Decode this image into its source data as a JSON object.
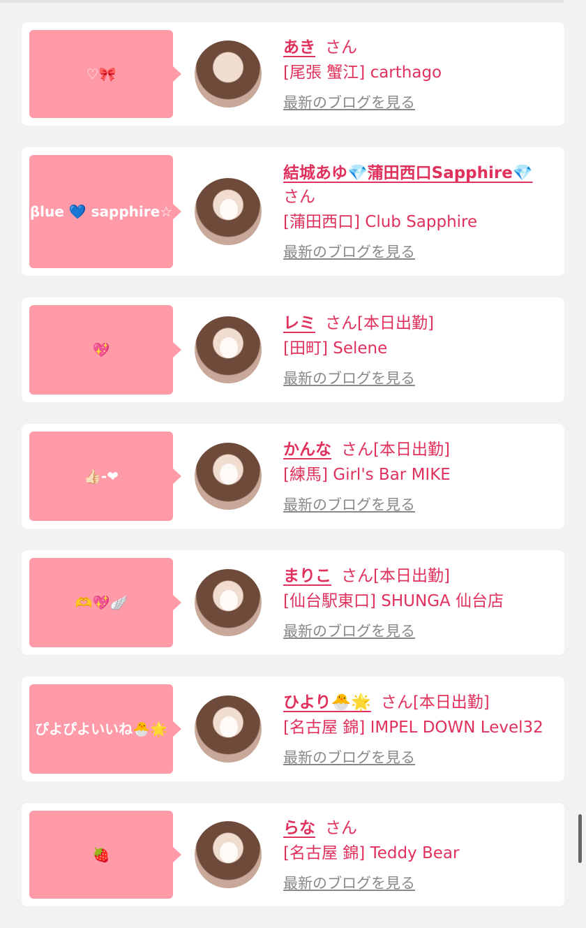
{
  "items": [
    {
      "bubble": "♡🎀",
      "name": "あき",
      "san": "さん",
      "shop": "[尾張 蟹江] carthago",
      "blog": "最新のブログを見る"
    },
    {
      "bubble": "βlue 💙 sapphire☆",
      "name": "結城あゆ💎蒲田西口Sapphire💎",
      "san": "さん",
      "shop": "[蒲田西口] Club Sapphire",
      "blog": "最新のブログを見る"
    },
    {
      "bubble": "💖",
      "name": "レミ",
      "san": "さん[本日出勤]",
      "shop": "[田町] Selene",
      "blog": "最新のブログを見る"
    },
    {
      "bubble": "👍🏻-❤",
      "name": "かんな",
      "san": "さん[本日出勤]",
      "shop": "[練馬] Girl's Bar MIKE",
      "blog": "最新のブログを見る"
    },
    {
      "bubble": "🫶💖🪽",
      "name": "まりこ",
      "san": "さん[本日出勤]",
      "shop": "[仙台駅東口] SHUNGA 仙台店",
      "blog": "最新のブログを見る"
    },
    {
      "bubble": "ぴよぴよいいね🐣🌟",
      "name": "ひより🐣🌟",
      "san": "さん[本日出勤]",
      "shop": "[名古屋 錦] IMPEL DOWN Level32",
      "blog": "最新のブログを見る"
    },
    {
      "bubble": "🍓",
      "name": "らな",
      "san": "さん",
      "shop": "[名古屋 錦] Teddy Bear",
      "blog": "最新のブログを見る"
    }
  ]
}
